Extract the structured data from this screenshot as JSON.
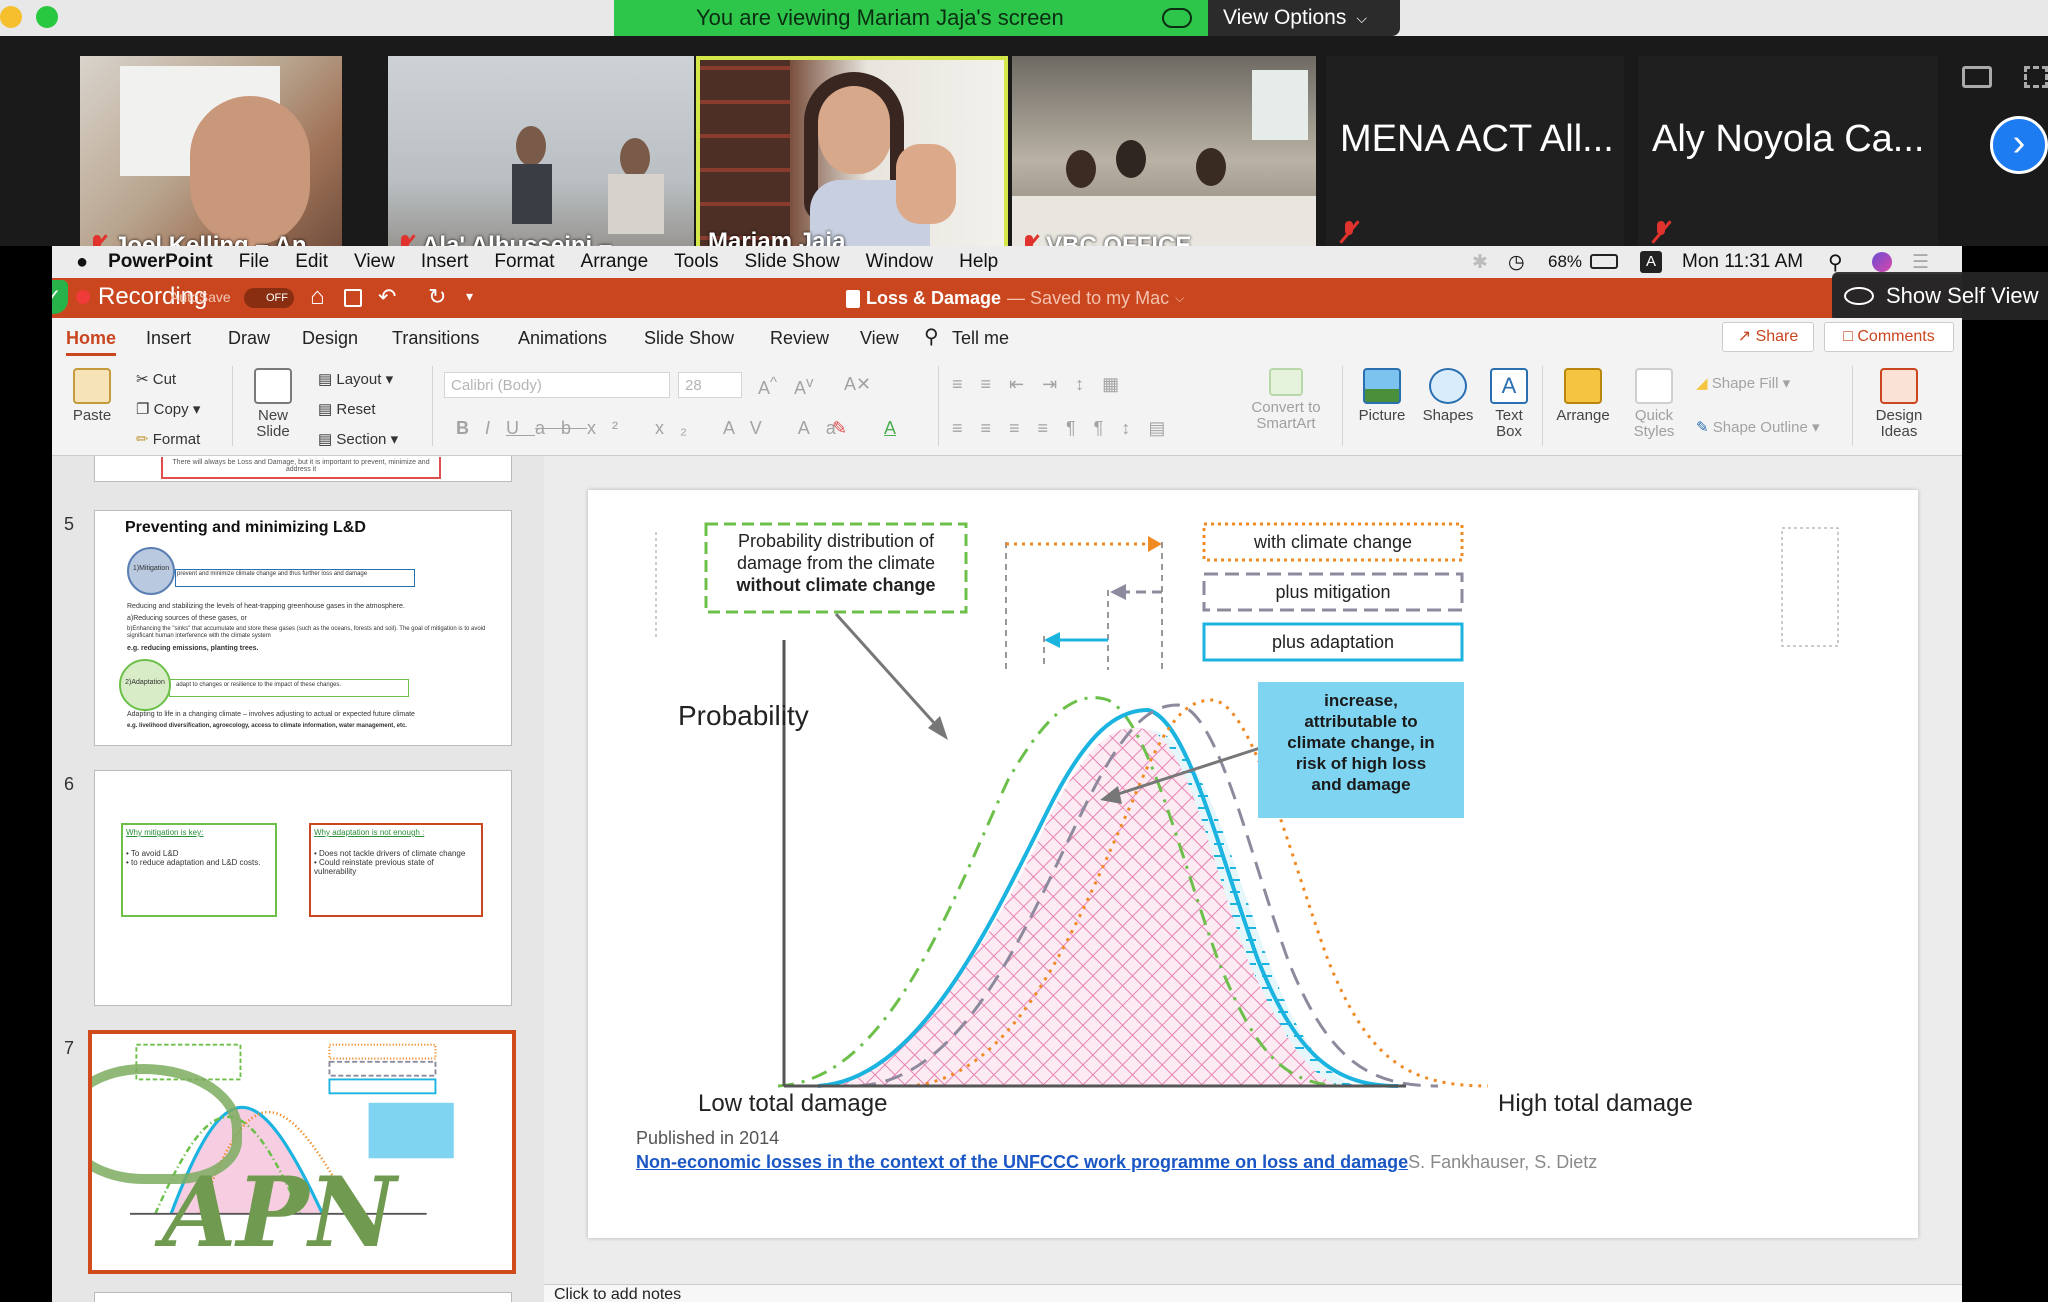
{
  "zoom": {
    "banner_text": "You are viewing Mariam Jaja's screen",
    "view_options": "View Options",
    "participants": [
      {
        "name": "Joel Kelling – An...",
        "muted": true
      },
      {
        "name": "Ala' Alhusseini –...",
        "muted": true
      },
      {
        "name": "Mariam Jaja",
        "muted": false,
        "active": true
      },
      {
        "name": "VBC OFFICE",
        "muted": true
      },
      {
        "name": "MENA ACT All...",
        "muted": true
      },
      {
        "name": "Aly Noyola Ca...",
        "muted": true
      }
    ],
    "recording_label": "Recording",
    "show_self_view": "Show Self View"
  },
  "mac_menu": {
    "app": "PowerPoint",
    "items": [
      "File",
      "Edit",
      "View",
      "Insert",
      "Format",
      "Arrange",
      "Tools",
      "Slide Show",
      "Window",
      "Help"
    ],
    "battery": "68%",
    "clock": "Mon 11:31 AM",
    "input_badge": "A"
  },
  "ppt": {
    "doc_title": "Loss & Damage",
    "saved_status": "— Saved to my Mac",
    "autosave_label": "AutoSave",
    "autosave_state": "OFF",
    "tabs": [
      "Home",
      "Insert",
      "Draw",
      "Design",
      "Transitions",
      "Animations",
      "Slide Show",
      "Review",
      "View"
    ],
    "tell_me": "Tell me",
    "share": "Share",
    "comments": "Comments",
    "ribbon": {
      "paste": "Paste",
      "cut": "Cut",
      "copy": "Copy",
      "format": "Format",
      "new_slide": "New Slide",
      "layout": "Layout",
      "reset": "Reset",
      "section": "Section",
      "font_name": "Calibri (Body)",
      "font_size": "28",
      "convert_smartart": "Convert to SmartArt",
      "picture": "Picture",
      "shapes": "Shapes",
      "text_box": "Text Box",
      "arrange": "Arrange",
      "quick_styles": "Quick Styles",
      "shape_fill": "Shape Fill",
      "shape_outline": "Shape Outline",
      "design_ideas": "Design Ideas"
    },
    "notes_placeholder": "Click to add notes"
  },
  "thumbnails": {
    "top_partial_text": "There will always be Loss and Damage, but it is important to prevent, minimize and address it",
    "slide5": {
      "number": "5",
      "title": "Preventing and minimizing L&D",
      "mitigation_badge": "1)Mitigation",
      "mitigation_box": "prevent and minimize climate change and thus further loss and damage",
      "line1": "Reducing and stabilizing the levels of heat-trapping greenhouse gases in the atmosphere.",
      "line2": "a)Reducing sources of these gases, or",
      "line3": "b)Enhancing the \"sinks\" that accumulate and store these gases (such as the oceans, forests and soil). The goal of mitigation is to avoid significant human interference with the climate system",
      "line4": "e.g. reducing emissions, planting trees.",
      "adaptation_badge": "2)Adaptation",
      "adaptation_box": "adapt to changes or resilience to the impact of these changes.",
      "line5": "Adapting to life in a changing climate – involves adjusting to actual or expected future climate",
      "line6": "e.g. livelihood diversification, agroecology, access to climate information, water management, etc."
    },
    "slide6": {
      "number": "6",
      "left_title": "Why mitigation is key:",
      "left_items": [
        "To avoid L&D",
        "to reduce adaptation and L&D costs."
      ],
      "right_title": "Why adaptation is not enough :",
      "right_items": [
        "Does not tackle drivers of climate change",
        "Could reinstate previous state of vulnerability"
      ]
    },
    "slide7": {
      "number": "7"
    },
    "watermark": "APN"
  },
  "slide": {
    "callout_line1": "Probability distribution of",
    "callout_line2": "damage from the climate",
    "callout_line3": "without climate change",
    "legend": {
      "with_cc": "with climate change",
      "plus_mitigation": "plus mitigation",
      "plus_adaptation": "plus adaptation"
    },
    "increase_box": [
      "increase,",
      "attributable to",
      "climate change, in",
      "risk of high loss",
      "and damage"
    ],
    "y_label": "Probability",
    "x_low": "Low total damage",
    "x_high": "High total damage",
    "published": "Published in 2014",
    "link_text": "Non-economic losses in the context of the UNFCCC work programme on loss and damage",
    "authors": "S. Fankhauser, S. Dietz"
  },
  "colors": {
    "zoom_green": "#2ec54b",
    "ppt_orange": "#c9461f",
    "legend_orange": "#f08a24",
    "mitigation_gray": "#8e8a9e",
    "adaptation_blue": "#1bb3e0",
    "no_cc_green": "#6cc04a",
    "increase_fill": "#7fd4f2",
    "pink_fill": "#f4b8d4"
  }
}
